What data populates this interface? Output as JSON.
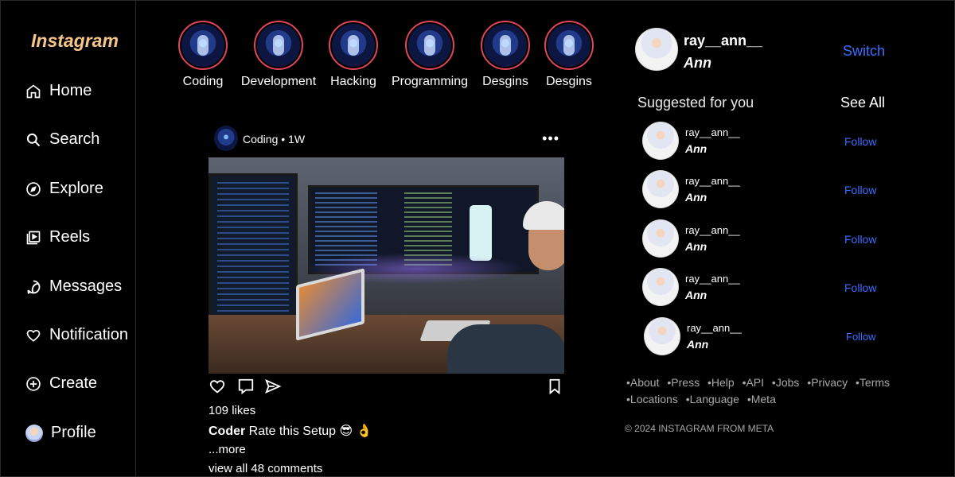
{
  "sidebar": {
    "logo": "Instagram",
    "items": [
      {
        "label": "Home",
        "icon": "home-icon"
      },
      {
        "label": "Search",
        "icon": "search-icon"
      },
      {
        "label": "Explore",
        "icon": "compass-icon"
      },
      {
        "label": "Reels",
        "icon": "reels-icon"
      },
      {
        "label": "Messages",
        "icon": "messenger-icon"
      },
      {
        "label": "Notification",
        "icon": "heart-icon"
      },
      {
        "label": "Create",
        "icon": "plus-circle-icon"
      },
      {
        "label": "Profile",
        "icon": "avatar"
      }
    ]
  },
  "stories": [
    {
      "label": "Coding"
    },
    {
      "label": "Development"
    },
    {
      "label": "Hacking"
    },
    {
      "label": "Programming"
    },
    {
      "label": "Desgins"
    },
    {
      "label": "Desgins"
    }
  ],
  "post": {
    "author_meta": "Coding • 1W",
    "more": "•••",
    "likes": "109 likes",
    "caption_user": "Coder",
    "caption_text": " Rate this Setup 😎 👌",
    "more_link": "...more",
    "comments_link": "view all 48 comments"
  },
  "profile": {
    "username": "ray__ann__",
    "name": "Ann",
    "switch_label": "Switch"
  },
  "suggestions": {
    "title": "Suggested for you",
    "see_all": "See All",
    "items": [
      {
        "username": "ray__ann__",
        "name": "Ann",
        "action": "Follow"
      },
      {
        "username": "ray__ann__",
        "name": "Ann",
        "action": "Follow"
      },
      {
        "username": "ray__ann__",
        "name": "Ann",
        "action": "Follow"
      },
      {
        "username": "ray__ann__",
        "name": "Ann",
        "action": "Follow"
      },
      {
        "username": "ray__ann__",
        "name": "Ann",
        "action": "Follow"
      }
    ]
  },
  "footer": {
    "links": [
      "•About",
      "•Press",
      "•Help",
      "•API",
      "•Jobs",
      "•Privacy",
      "•Terms",
      "•Locations",
      "•Language",
      "•Meta"
    ],
    "copyright": "© 2024 INSTAGRAM FROM META"
  },
  "colors": {
    "background": "#000000",
    "logo": "#f6c58a",
    "link_blue": "#3b6dff",
    "story_ring": "#e0455b",
    "muted": "#a8a8a8"
  }
}
